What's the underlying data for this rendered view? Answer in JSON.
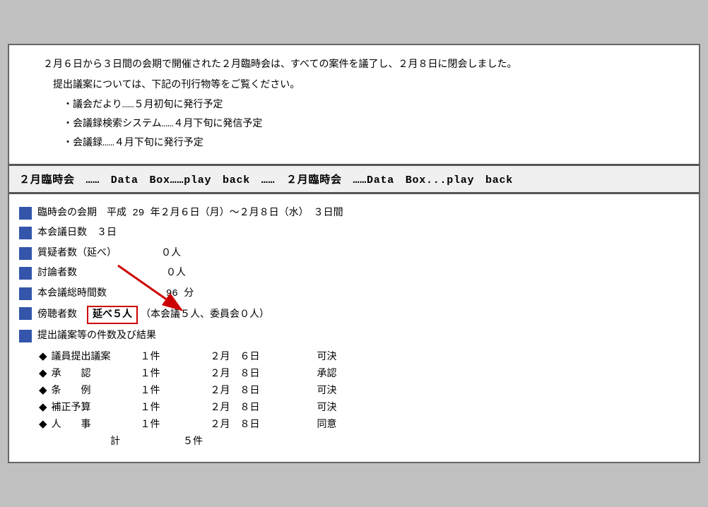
{
  "top": {
    "para1": "２月６日から３日間の会期で開催された２月臨時会は、すべての案件を議了し、２月８日に閉会しました。",
    "para2": "提出議案については、下記の刊行物等をご覧ください。",
    "bullet1": "・議会だより……５月初旬に発行予定",
    "bullet2": "・会議録検索システム……４月下旬に発信予定",
    "bullet3": "・会議録……４月下旬に発行予定"
  },
  "banner": {
    "text": "２月臨時会　……　Data　Box……play　back　……　２月臨時会　……Data　Box...play　back"
  },
  "items": [
    {
      "label": "臨時会の会期　平成 29 年２月６日（月）～２月８日（水）　３日間"
    },
    {
      "label": "本会議日数　３日"
    },
    {
      "label": "質疑者数（延べ）　　　　　０人"
    },
    {
      "label": "討論者数　　　　　　　　　０人"
    },
    {
      "label": "本会議総時間数　　　　　　96 分"
    },
    {
      "label_pre": "傍聴者数　",
      "highlighted": "延べ５人",
      "label_post": "（本会議５人、委員会０人）",
      "has_highlight": true,
      "has_arrow": true
    },
    {
      "label": "提出議案等の件数及び結果",
      "has_subtable": true
    }
  ],
  "subtable": {
    "rows": [
      {
        "bullet": "◆",
        "col1": "議員提出議案",
        "col2": "１件",
        "col3": "２月　６日",
        "col4": "可決"
      },
      {
        "bullet": "◆",
        "col1": "承　　認",
        "col2": "１件",
        "col3": "２月　８日",
        "col4": "承認"
      },
      {
        "bullet": "◆",
        "col1": "条　　例",
        "col2": "１件",
        "col3": "２月　８日",
        "col4": "可決"
      },
      {
        "bullet": "◆",
        "col1": "補正予算",
        "col2": "１件",
        "col3": "２月　８日",
        "col4": "可決"
      },
      {
        "bullet": "◆",
        "col1": "人　　事",
        "col2": "１件",
        "col3": "２月　８日",
        "col4": "同意"
      }
    ],
    "total_label": "計",
    "total_value": "５件"
  }
}
